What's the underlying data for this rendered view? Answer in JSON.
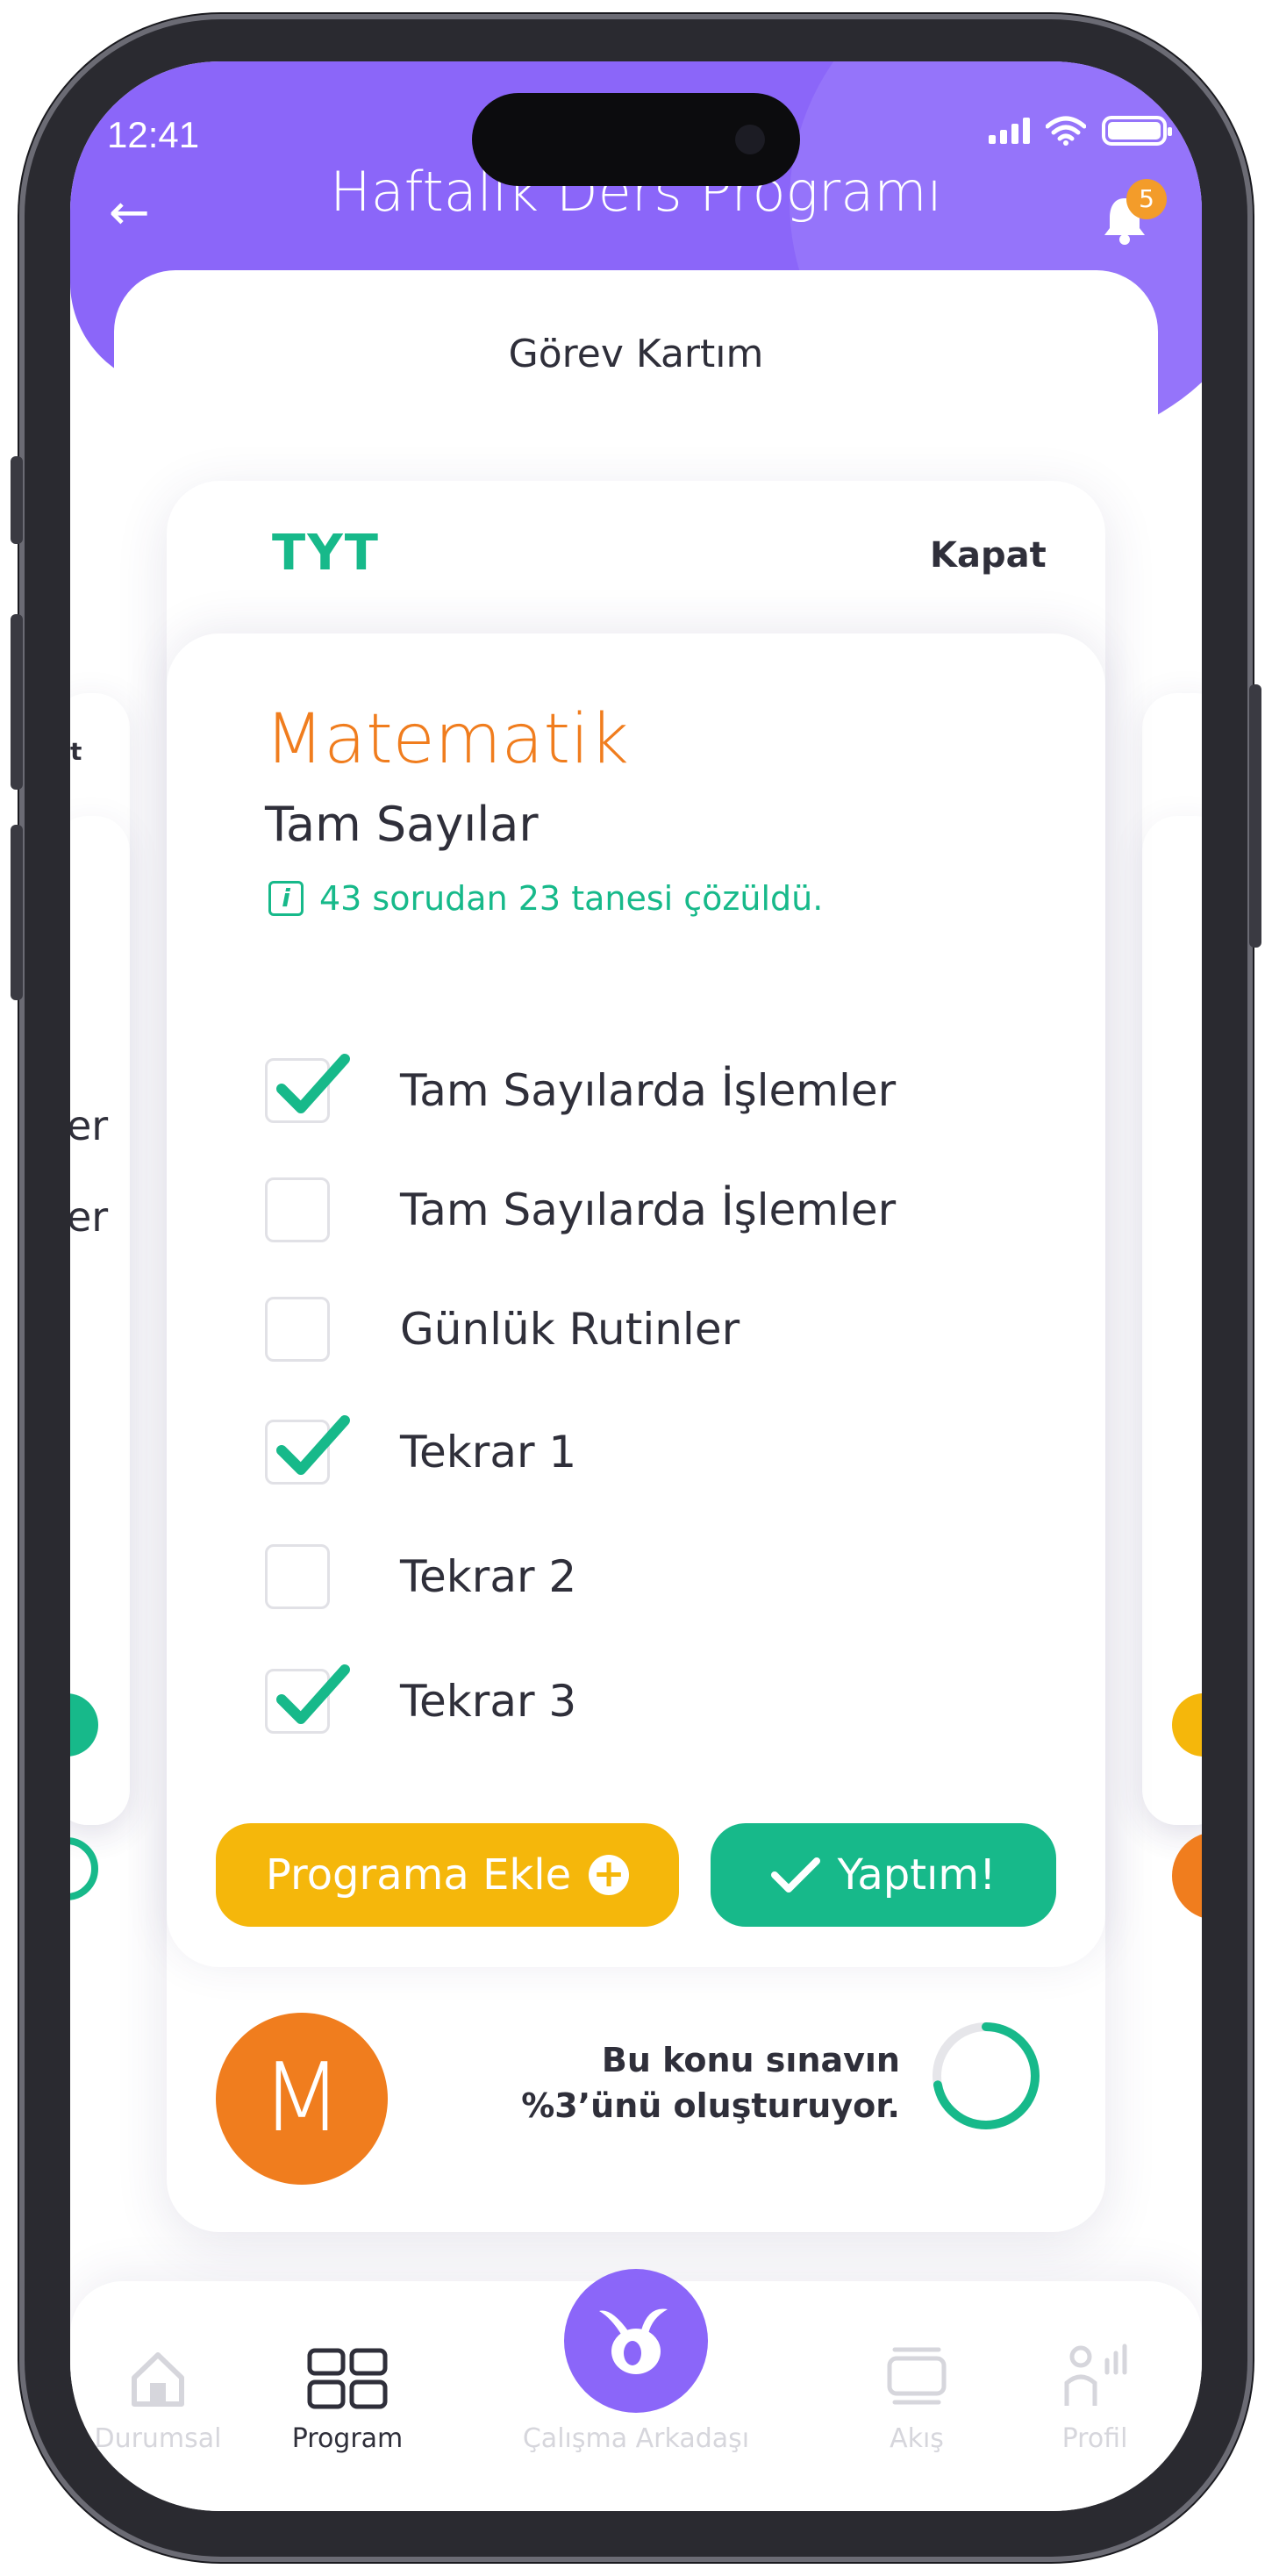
{
  "status_bar": {
    "time": "12:41"
  },
  "header": {
    "title": "Haftalık Ders Programı",
    "notification_count": "5",
    "subtitle": "Görev Kartım"
  },
  "card": {
    "exam": "TYT",
    "close_label": "Kapat",
    "subject": "Matematik",
    "topic": "Tam Sayılar",
    "progress_info": "43 sorudan 23 tanesi çözüldü.",
    "tasks": [
      {
        "label": "Tam Sayılarda İşlemler",
        "checked": true
      },
      {
        "label": "Tam Sayılarda İşlemler",
        "checked": false
      },
      {
        "label": "Günlük Rutinler",
        "checked": false
      },
      {
        "label": "Tekrar 1",
        "checked": true
      },
      {
        "label": "Tekrar 2",
        "checked": false
      },
      {
        "label": "Tekrar 3",
        "checked": true
      }
    ],
    "add_button": "Programa Ekle",
    "done_button": "Yaptım!",
    "avatar_letter": "M",
    "share_line1": "Bu konu sınavın",
    "share_line2": "%3’ünü oluşturuyor.",
    "share_percent": 3
  },
  "side_cards": {
    "left_fragment_1": "er",
    "left_fragment_2": "er",
    "left_fragment_top": "t"
  },
  "nav": {
    "items": [
      {
        "label": "Durumsal",
        "icon": "home-icon"
      },
      {
        "label": "Program",
        "icon": "grid-icon"
      },
      {
        "label": "Çalışma Arkadaşı",
        "icon": "rabbit-icon"
      },
      {
        "label": "Akış",
        "icon": "stack-icon"
      },
      {
        "label": "Profil",
        "icon": "profile-icon"
      }
    ],
    "active": "Program"
  },
  "colors": {
    "primary": "#8b66f9",
    "success": "#17b98a",
    "subject": "#f07d1e",
    "warning": "#f5b70b"
  }
}
